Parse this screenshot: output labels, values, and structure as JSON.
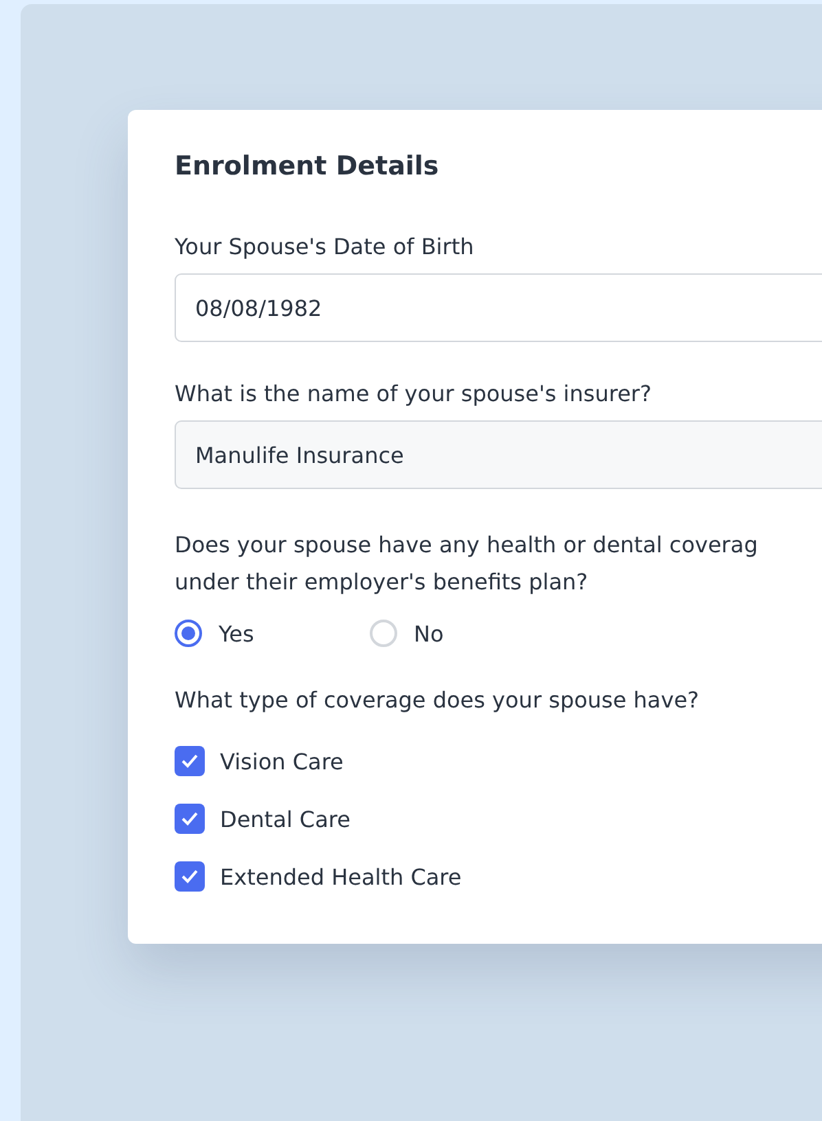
{
  "title": "Enrolment Details",
  "fields": [
    {
      "label": "Your Spouse's Date of Birth",
      "value": "08/08/1982",
      "kind": "date"
    },
    {
      "label": "What is the name of your spouse's insurer?",
      "value": "Manulife Insurance",
      "kind": "text"
    }
  ],
  "coverage_question": {
    "lines": [
      "Does your spouse have any health or dental coverag",
      "under their employer's benefits plan?"
    ],
    "options": [
      {
        "label": "Yes",
        "selected": true
      },
      {
        "label": "No",
        "selected": false
      }
    ]
  },
  "coverage_types": {
    "label": "What type of coverage does your spouse have?",
    "options": [
      {
        "label": "Vision Care",
        "checked": true
      },
      {
        "label": "Dental Care",
        "checked": true
      },
      {
        "label": "Extended Health Care",
        "checked": true
      }
    ]
  }
}
